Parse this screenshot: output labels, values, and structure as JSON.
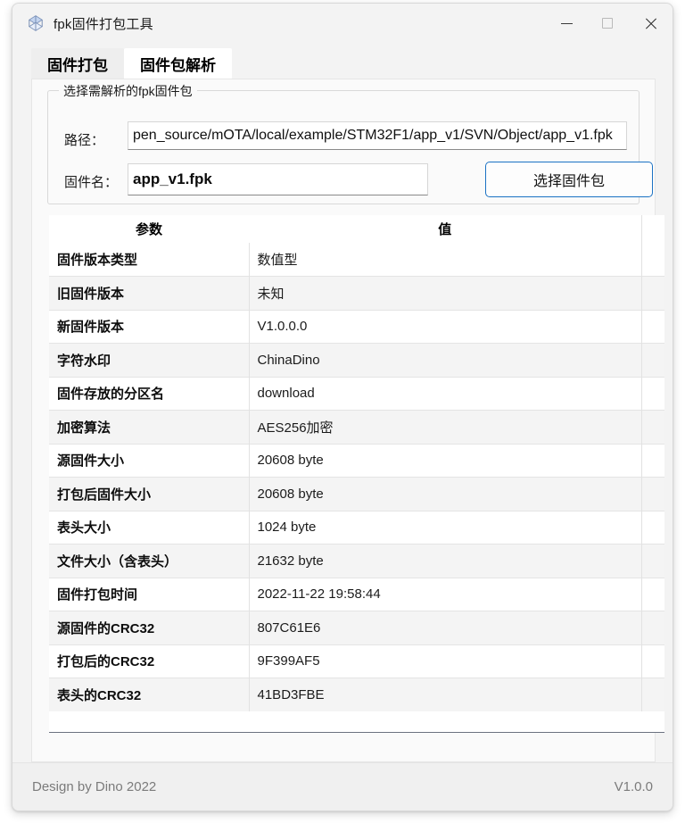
{
  "window": {
    "title": "fpk固件打包工具",
    "icon": "app-logo-icon",
    "controls": {
      "minimize": "minimize-icon",
      "maximize": "maximize-icon",
      "close": "close-icon"
    }
  },
  "tabs": [
    {
      "label": "固件打包",
      "active": false
    },
    {
      "label": "固件包解析",
      "active": true
    }
  ],
  "groupbox": {
    "legend": "选择需解析的fpk固件包",
    "path_label": "路径：",
    "path_value": "pen_source/mOTA/local/example/STM32F1/app_v1/SVN/Object/app_v1.fpk",
    "path_placeholder": "",
    "name_label": "固件名：",
    "name_value": "app_v1.fpk",
    "name_placeholder": "",
    "select_button": "选择固件包"
  },
  "table": {
    "headers": [
      "参数",
      "值",
      ""
    ],
    "rows": [
      {
        "key": "固件版本类型",
        "value": "数值型"
      },
      {
        "key": "旧固件版本",
        "value": "未知"
      },
      {
        "key": "新固件版本",
        "value": "V1.0.0.0"
      },
      {
        "key": "字符水印",
        "value": "ChinaDino"
      },
      {
        "key": "固件存放的分区名",
        "value": "download"
      },
      {
        "key": "加密算法",
        "value": "AES256加密"
      },
      {
        "key": "源固件大小",
        "value": "20608 byte"
      },
      {
        "key": "打包后固件大小",
        "value": "20608 byte"
      },
      {
        "key": "表头大小",
        "value": "1024 byte"
      },
      {
        "key": "文件大小（含表头）",
        "value": "21632 byte"
      },
      {
        "key": "固件打包时间",
        "value": "2022-11-22 19:58:44"
      },
      {
        "key": "源固件的CRC32",
        "value": "807C61E6"
      },
      {
        "key": "打包后的CRC32",
        "value": "9F399AF5"
      },
      {
        "key": "表头的CRC32",
        "value": "41BD3FBE"
      }
    ]
  },
  "footer": {
    "credit": "Design by Dino 2022",
    "version": "V1.0.0"
  },
  "colors": {
    "accent": "#1b72c4",
    "window_bg": "#f3f3f3",
    "row_alt": "#f4f4f4",
    "footer_text": "#7b7b7b"
  }
}
